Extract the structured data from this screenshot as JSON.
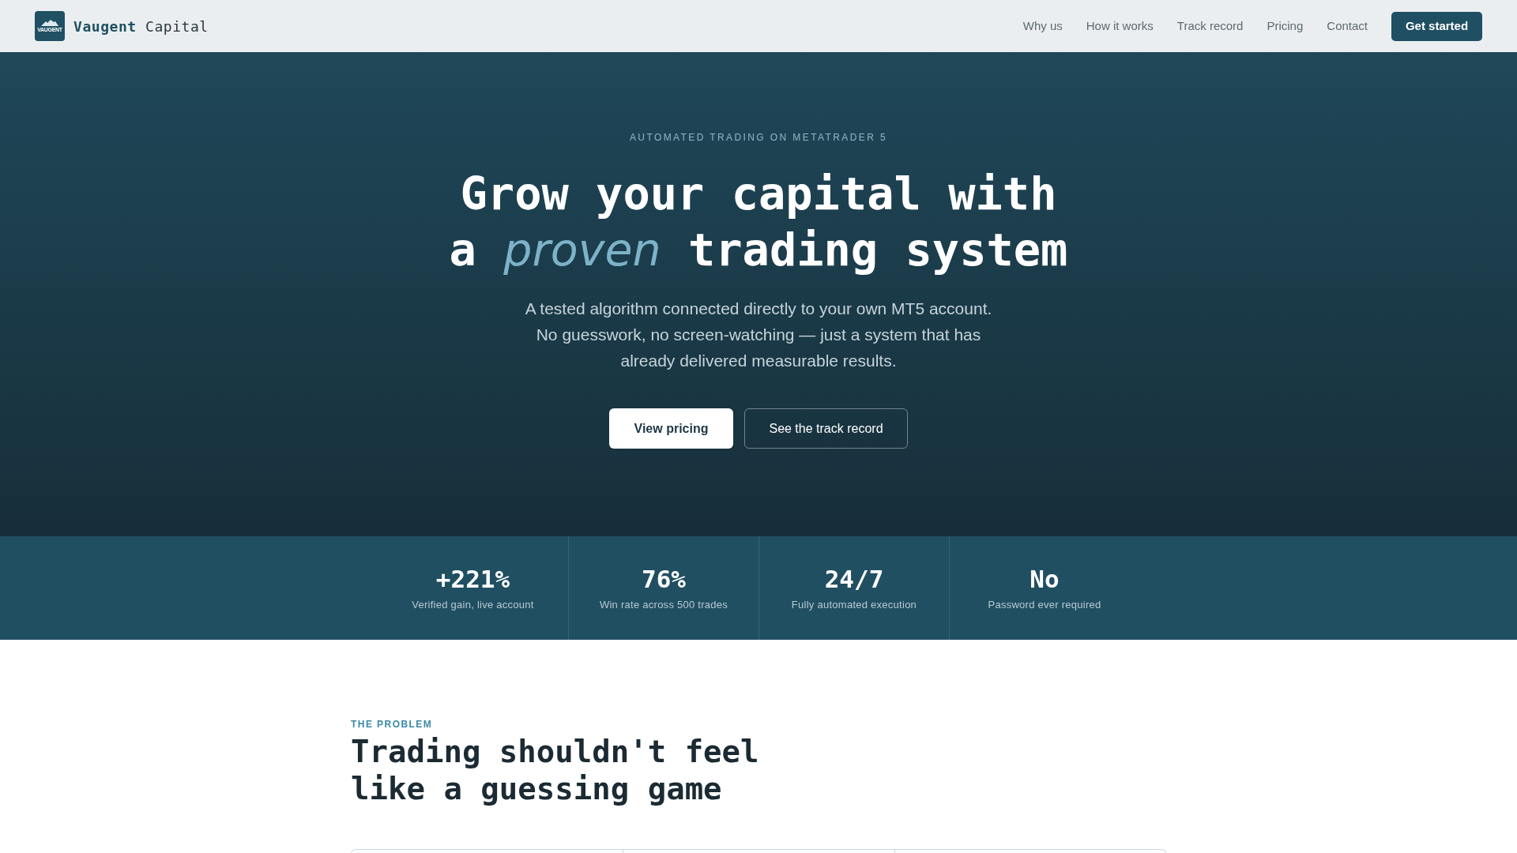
{
  "header": {
    "brand": {
      "logo_text": "VAUGENT",
      "name": "**Vaugent** Capital"
    },
    "nav": [
      "Why us",
      "How it works",
      "Track record",
      "Pricing",
      "Contact"
    ],
    "cta": "Get started"
  },
  "hero": {
    "eyebrow": "AUTOMATED TRADING ON METATRADER 5",
    "headline": "Grow your capital with a *proven* trading system",
    "subtitle": "A tested algorithm connected directly to your own MT5 account. No guesswork, no screen-watching — just a system that has already delivered measurable results.",
    "buttons": [
      {
        "label": "View pricing",
        "kind": "primary"
      },
      {
        "label": "See the track record",
        "kind": "secondary"
      }
    ]
  },
  "stats": [
    {
      "value": "+221%",
      "label": "Verified gain, live account"
    },
    {
      "value": "76%",
      "label": "Win rate across 500 trades"
    },
    {
      "value": "24/7",
      "label": "Fully automated execution"
    },
    {
      "value": "No",
      "label": "Password ever required"
    }
  ],
  "problem": {
    "eyebrow": "THE PROBLEM",
    "heading": "Trading shouldn't feel like a guessing game"
  }
}
